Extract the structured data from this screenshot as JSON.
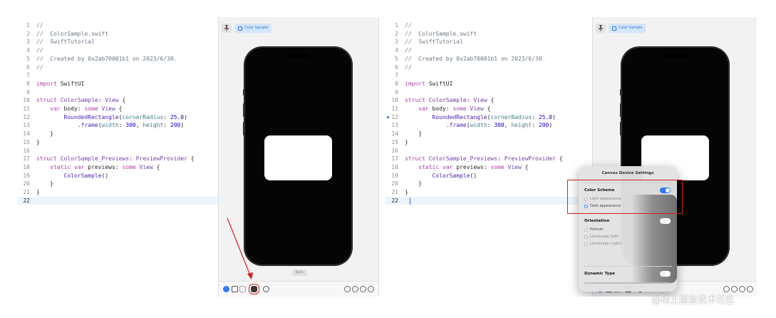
{
  "code_lines": [
    {
      "n": "1",
      "t": [
        [
          "comment",
          "//"
        ]
      ]
    },
    {
      "n": "2",
      "t": [
        [
          "comment",
          "//  ColorSample.swift"
        ]
      ]
    },
    {
      "n": "3",
      "t": [
        [
          "comment",
          "//  SwiftTutorial"
        ]
      ]
    },
    {
      "n": "4",
      "t": [
        [
          "comment",
          "//"
        ]
      ]
    },
    {
      "n": "5",
      "t": [
        [
          "comment",
          "//  Created by 0x2ab70001b1 on 2023/6/30."
        ]
      ]
    },
    {
      "n": "6",
      "t": [
        [
          "comment",
          "//"
        ]
      ]
    },
    {
      "n": "7",
      "t": []
    },
    {
      "n": "8",
      "t": [
        [
          "keyword",
          "import"
        ],
        [
          "plain",
          " SwiftUI"
        ]
      ]
    },
    {
      "n": "9",
      "t": []
    },
    {
      "n": "10",
      "t": [
        [
          "keyword",
          "struct"
        ],
        [
          "plain",
          " "
        ],
        [
          "type",
          "ColorSample"
        ],
        [
          "plain",
          ": "
        ],
        [
          "type",
          "View"
        ],
        [
          "plain",
          " {"
        ]
      ]
    },
    {
      "n": "11",
      "t": [
        [
          "plain",
          "    "
        ],
        [
          "keyword",
          "var"
        ],
        [
          "plain",
          " body: "
        ],
        [
          "keyword",
          "some"
        ],
        [
          "plain",
          " "
        ],
        [
          "type",
          "View"
        ],
        [
          "plain",
          " {"
        ]
      ]
    },
    {
      "n": "12",
      "t": [
        [
          "plain",
          "        "
        ],
        [
          "func",
          "RoundedRectangle"
        ],
        [
          "plain",
          "("
        ],
        [
          "param",
          "cornerRadius"
        ],
        [
          "plain",
          ": "
        ],
        [
          "number",
          "25.0"
        ],
        [
          "plain",
          ")"
        ]
      ]
    },
    {
      "n": "13",
      "t": [
        [
          "plain",
          "            ."
        ],
        [
          "func",
          "frame"
        ],
        [
          "plain",
          "("
        ],
        [
          "param",
          "width"
        ],
        [
          "plain",
          ": "
        ],
        [
          "number",
          "300"
        ],
        [
          "plain",
          ", "
        ],
        [
          "param",
          "height"
        ],
        [
          "plain",
          ": "
        ],
        [
          "number",
          "200"
        ],
        [
          "plain",
          ")"
        ]
      ]
    },
    {
      "n": "14",
      "t": [
        [
          "plain",
          "    }"
        ]
      ]
    },
    {
      "n": "15",
      "t": [
        [
          "plain",
          "}"
        ]
      ]
    },
    {
      "n": "16",
      "t": []
    },
    {
      "n": "17",
      "t": [
        [
          "keyword",
          "struct"
        ],
        [
          "plain",
          " "
        ],
        [
          "type",
          "ColorSample_Previews"
        ],
        [
          "plain",
          ": "
        ],
        [
          "type",
          "PreviewProvider"
        ],
        [
          "plain",
          " {"
        ]
      ]
    },
    {
      "n": "18",
      "t": [
        [
          "plain",
          "    "
        ],
        [
          "keyword",
          "static"
        ],
        [
          "plain",
          " "
        ],
        [
          "keyword",
          "var"
        ],
        [
          "plain",
          " previews: "
        ],
        [
          "keyword",
          "some"
        ],
        [
          "plain",
          " "
        ],
        [
          "type",
          "View"
        ],
        [
          "plain",
          " {"
        ]
      ]
    },
    {
      "n": "19",
      "t": [
        [
          "plain",
          "        "
        ],
        [
          "func",
          "ColorSample"
        ],
        [
          "plain",
          "()"
        ]
      ]
    },
    {
      "n": "20",
      "t": [
        [
          "plain",
          "    }"
        ]
      ]
    },
    {
      "n": "21",
      "t": [
        [
          "plain",
          "}"
        ]
      ]
    },
    {
      "n": "22",
      "t": []
    }
  ],
  "preview": {
    "chip_label": "Color Sample",
    "device_label": "Dark"
  },
  "popover": {
    "title": "Canvas Device Settings",
    "color_scheme": {
      "label": "Color Scheme",
      "enabled": true,
      "options": [
        {
          "label": "Light appearance",
          "selected": false
        },
        {
          "label": "Dark appearance",
          "selected": true
        }
      ]
    },
    "orientation": {
      "label": "Orientation",
      "enabled": false,
      "options": [
        {
          "label": "Portrait",
          "selected": true
        },
        {
          "label": "Landscape (left)",
          "selected": false
        },
        {
          "label": "Landscape (right)",
          "selected": false
        }
      ]
    },
    "dynamic_type": {
      "label": "Dynamic Type",
      "enabled": false
    }
  },
  "watermark": "@稀土掘金技术社区",
  "colors": {
    "accent": "#2f7cf6",
    "highlight": "#d81e1e",
    "phone_screen": "#050505"
  },
  "icons": [
    "pin-icon",
    "preview-chip-icon",
    "live-play-icon",
    "selectable-icon",
    "variants-icon",
    "device-settings-icon",
    "settings-icon",
    "zoom-out-icon",
    "zoom-actual-icon",
    "zoom-in-icon",
    "zoom-fit-icon"
  ]
}
